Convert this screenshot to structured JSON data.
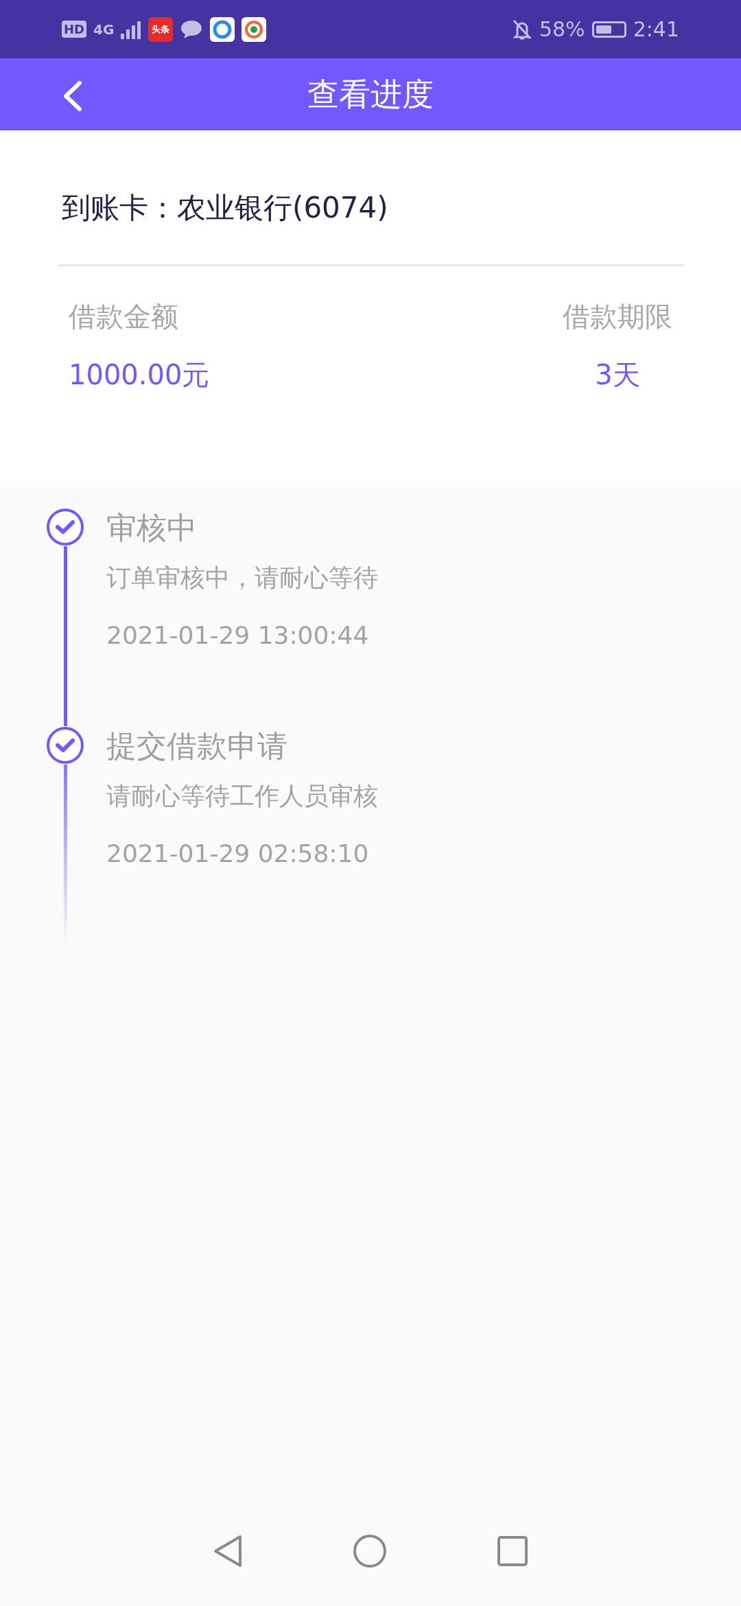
{
  "status_bar": {
    "hd": "HD",
    "network": "4G",
    "app_badge": "头条",
    "battery_percent": "58%",
    "time": "2:41"
  },
  "header": {
    "title": "查看进度"
  },
  "card": {
    "account_label": "到账卡：",
    "account_value": "农业银行(6074)",
    "stats": [
      {
        "label": "借款金额",
        "value": "1000.00元"
      },
      {
        "label": "借款期限",
        "value": "3天"
      }
    ]
  },
  "timeline": [
    {
      "title": "审核中",
      "desc": "订单审核中，请耐心等待",
      "time": "2021-01-29 13:00:44"
    },
    {
      "title": "提交借款申请",
      "desc": "请耐心等待工作人员审核",
      "time": "2021-01-29 02:58:10"
    }
  ]
}
